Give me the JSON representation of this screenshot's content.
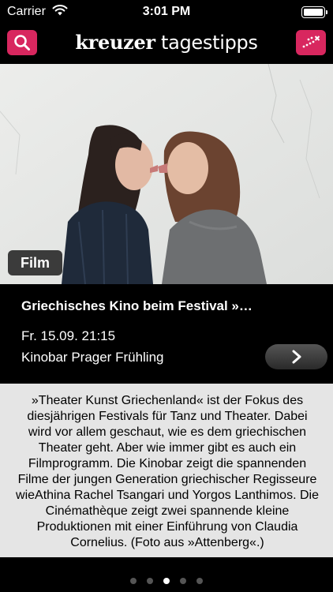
{
  "status_bar": {
    "carrier": "Carrier",
    "time": "3:01 PM"
  },
  "header": {
    "logo_brand": "kreuzer",
    "logo_sub": "tagestipps"
  },
  "event": {
    "category": "Film",
    "title": "Griechisches Kino beim Festival »…",
    "datetime": "Fr. 15.09. 21:15",
    "venue": "Kinobar Prager Frühling",
    "description": "»Theater Kunst Griechenland« ist der Fokus des diesjährigen Festivals für Tanz und Theater. Dabei wird vor allem geschaut, wie es dem griechischen Theater geht. Aber wie immer gibt es auch ein Filmprogramm. Die Kinobar zeigt die spannenden Filme der jungen Generation griechischer Regisseure wieAthina Rachel Tsangari und Yorgos Lanthimos. Die Cinémathèque zeigt zwei spannende kleine Produktionen mit einer Einführung von Claudia Cornelius. (Foto aus »Attenberg«.)"
  },
  "pager": {
    "count": 5,
    "active_index": 2
  },
  "colors": {
    "accent": "#d8275f",
    "panel": "#e5e5e5",
    "background": "#000000"
  }
}
